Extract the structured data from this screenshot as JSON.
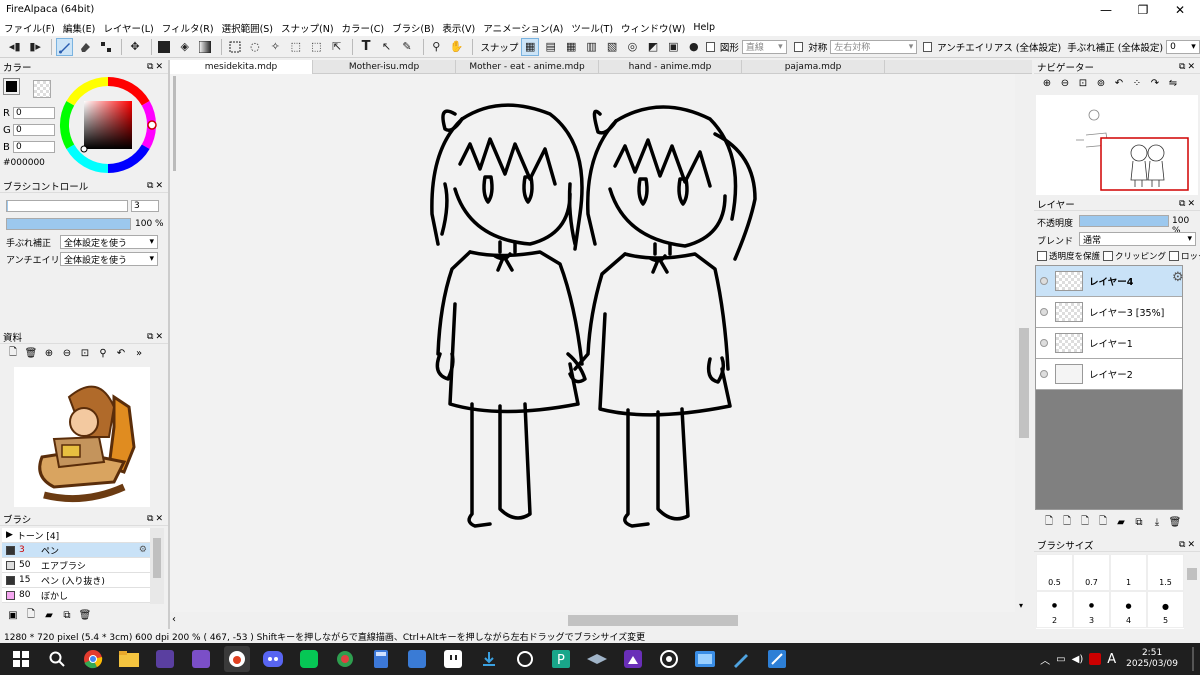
{
  "window": {
    "title": "FireAlpaca (64bit)",
    "minimize": "—",
    "maximize": "❐",
    "close": "✕"
  },
  "menu": [
    "ファイル(F)",
    "編集(E)",
    "レイヤー(L)",
    "フィルタ(R)",
    "選択範囲(S)",
    "スナップ(N)",
    "カラー(C)",
    "ブラシ(B)",
    "表示(V)",
    "アニメーション(A)",
    "ツール(T)",
    "ウィンドウ(W)",
    "Help"
  ],
  "toolbar": {
    "snap_label": "スナップ",
    "shape_label": "図形",
    "shape_value": "直線",
    "symmetry_label": "対称",
    "symmetry_value": "左右対称",
    "antialias_label": "アンチエイリアス (全体設定)",
    "stabilizer_label": "手ぶれ補正 (全体設定)",
    "stabilizer_value": "0"
  },
  "color_panel": {
    "title": "カラー",
    "r_label": "R",
    "r_value": "0",
    "g_label": "G",
    "g_value": "0",
    "b_label": "B",
    "b_value": "0",
    "hex": "#000000",
    "primary": "#000000"
  },
  "brush_control": {
    "title": "ブラシコントロール",
    "size_value": "3",
    "size_fill": 0.01,
    "opacity_value": "100 %",
    "opacity_fill": 1.0,
    "stabilizer_label": "手ぶれ補正",
    "stabilizer_value": "全体設定を使う",
    "antialias_label": "アンチエイリアス",
    "antialias_value": "全体設定を使う"
  },
  "material_panel": {
    "title": "資料"
  },
  "brush_panel": {
    "title": "ブラシ",
    "group": "トーン [4]",
    "items": [
      {
        "size": "3",
        "name": "ペン",
        "swatch": "#333333",
        "selected": true
      },
      {
        "size": "50",
        "name": "エアブラシ",
        "swatch": "#dddddd",
        "selected": false
      },
      {
        "size": "15",
        "name": "ペン (入り抜き)",
        "swatch": "#333333",
        "selected": false
      },
      {
        "size": "80",
        "name": "ぼかし",
        "swatch": "#f4a6f0",
        "selected": false
      }
    ]
  },
  "tabs": [
    "mesidekita.mdp",
    "Mother-isu.mdp",
    "Mother - eat - anime.mdp",
    "hand - anime.mdp",
    "pajama.mdp"
  ],
  "navigator": {
    "title": "ナビゲーター"
  },
  "layer_panel": {
    "title": "レイヤー",
    "opacity_label": "不透明度",
    "opacity_value": "100 %",
    "opacity_fill": 1.0,
    "blend_label": "ブレンド",
    "blend_value": "通常",
    "protect_label": "透明度を保護",
    "clip_label": "クリッピング",
    "lock_label": "ロック",
    "layers": [
      {
        "name": "レイヤー4",
        "selected": true
      },
      {
        "name": "レイヤー3 [35%]",
        "selected": false
      },
      {
        "name": "レイヤー1",
        "selected": false
      },
      {
        "name": "レイヤー2",
        "selected": false
      }
    ]
  },
  "brush_size_panel": {
    "title": "ブラシサイズ",
    "row1": [
      "0.5",
      "0.7",
      "1",
      "1.5"
    ],
    "row2": [
      "2",
      "3",
      "4",
      "5"
    ]
  },
  "status": "1280 * 720 pixel   (5.4 * 3cm)   600 dpi   200 %   ( 467, -53 )   Shiftキーを押しながらで直線描画、Ctrl+Altキーを押しながら左右ドラッグでブラシサイズ変更",
  "taskbar": {
    "time": "2:51",
    "date": "2025/03/09",
    "ime": "A"
  }
}
